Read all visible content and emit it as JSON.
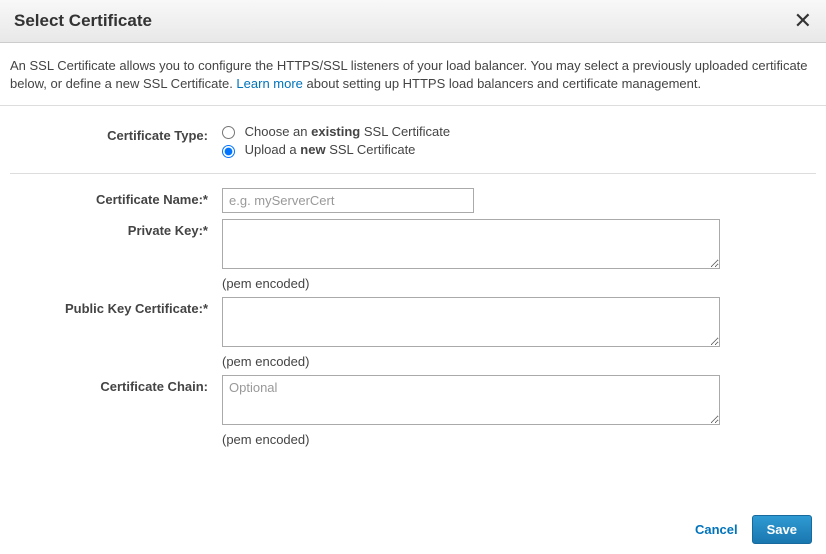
{
  "header": {
    "title": "Select Certificate"
  },
  "description": {
    "text_part1": "An SSL Certificate allows you to configure the HTTPS/SSL listeners of your load balancer. You may select a previously uploaded certificate below, or define a new SSL Certificate. ",
    "link": "Learn more",
    "text_part2": " about setting up HTTPS load balancers and certificate management."
  },
  "cert_type": {
    "label": "Certificate Type:",
    "option_existing_prefix": "Choose an ",
    "option_existing_bold": "existing",
    "option_existing_suffix": " SSL Certificate",
    "option_upload_prefix": "Upload a ",
    "option_upload_bold": "new",
    "option_upload_suffix": " SSL Certificate"
  },
  "fields": {
    "name": {
      "label": "Certificate Name:*",
      "placeholder": "e.g. myServerCert"
    },
    "private_key": {
      "label": "Private Key:*",
      "hint": "(pem encoded)"
    },
    "public_key": {
      "label": "Public Key Certificate:*",
      "hint": "(pem encoded)"
    },
    "chain": {
      "label": "Certificate Chain:",
      "placeholder": "Optional",
      "hint": "(pem encoded)"
    }
  },
  "footer": {
    "cancel": "Cancel",
    "save": "Save"
  }
}
